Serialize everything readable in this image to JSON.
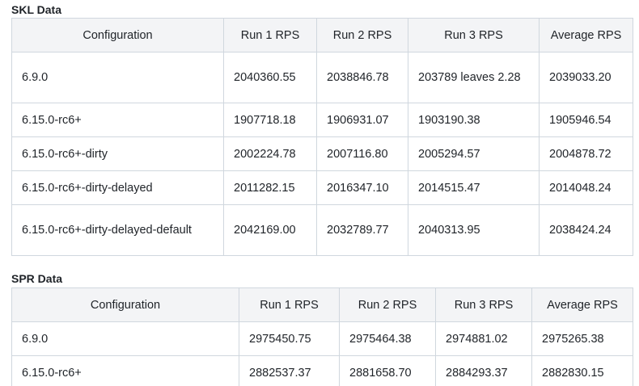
{
  "skl": {
    "title": "SKL Data",
    "headers": [
      "Configuration",
      "Run 1 RPS",
      "Run 2 RPS",
      "Run 3 RPS",
      "Average RPS"
    ],
    "rows": [
      [
        "6.9.0",
        "2040360.55",
        "2038846.78",
        "203789 leaves 2.28",
        "2039033.20"
      ],
      [
        "6.15.0-rc6+",
        "1907718.18",
        "1906931.07",
        "1903190.38",
        "1905946.54"
      ],
      [
        "6.15.0-rc6+-dirty",
        "2002224.78",
        "2007116.80",
        "2005294.57",
        "2004878.72"
      ],
      [
        "6.15.0-rc6+-dirty-delayed",
        "2011282.15",
        "2016347.10",
        "2014515.47",
        "2014048.24"
      ],
      [
        "6.15.0-rc6+-dirty-delayed-default",
        "2042169.00",
        "2032789.77",
        "2040313.95",
        "2038424.24"
      ]
    ]
  },
  "spr": {
    "title": "SPR Data",
    "headers": [
      "Configuration",
      "Run 1 RPS",
      "Run 2 RPS",
      "Run 3 RPS",
      "Average RPS"
    ],
    "rows": [
      [
        "6.9.0",
        "2975450.75",
        "2975464.38",
        "2974881.02",
        "2975265.38"
      ],
      [
        "6.15.0-rc6+",
        "2882537.37",
        "2881658.70",
        "2884293.37",
        "2882830.15"
      ]
    ]
  }
}
